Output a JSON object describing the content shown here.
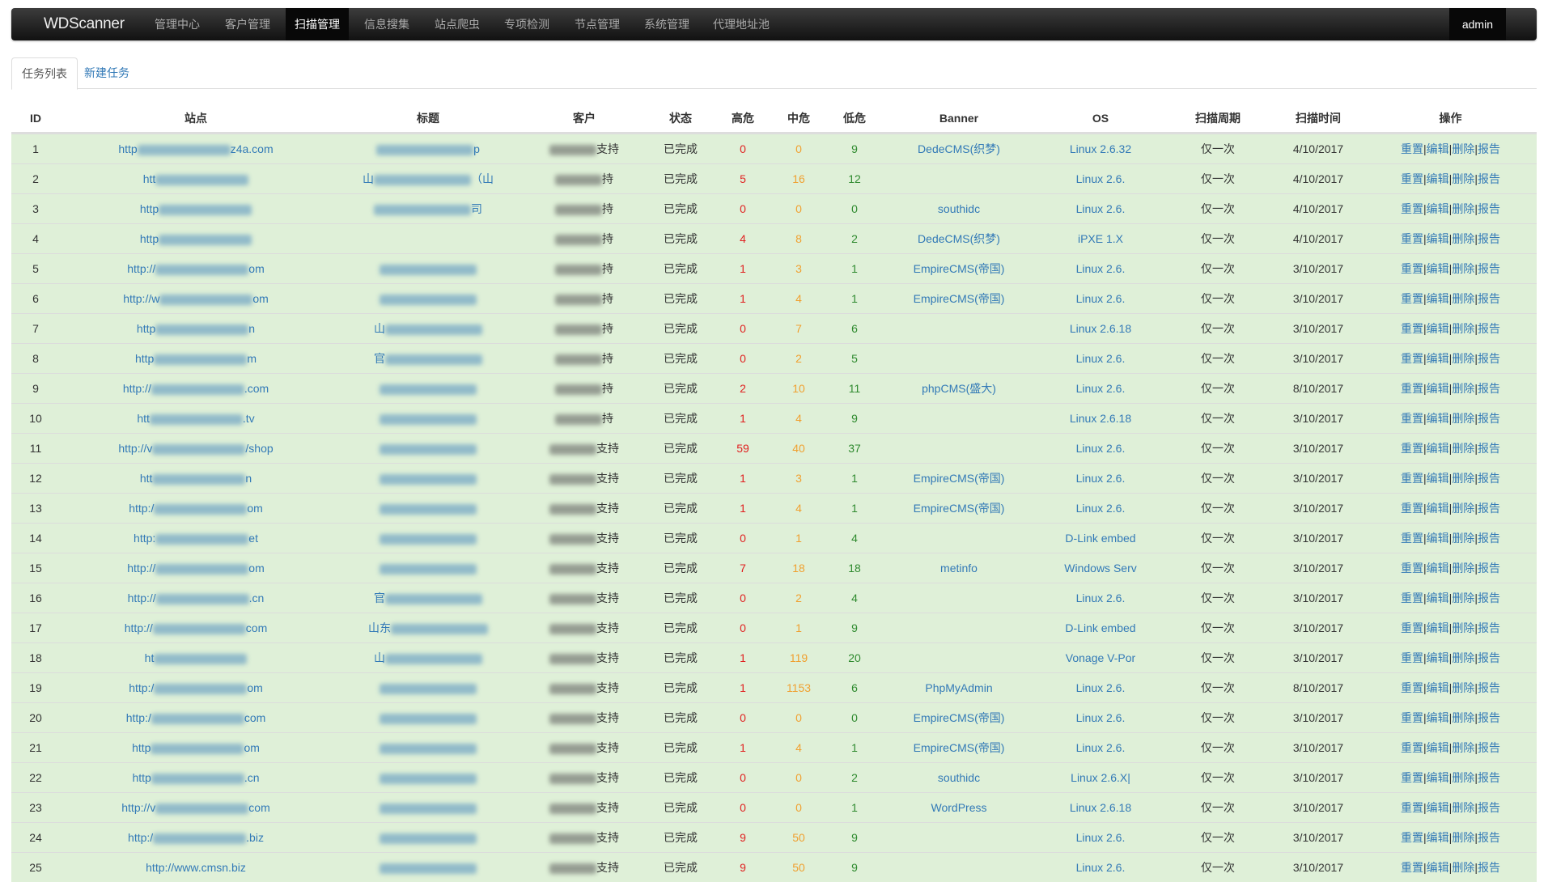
{
  "navbar": {
    "brand": "WDScanner",
    "items": [
      "管理中心",
      "客户管理",
      "扫描管理",
      "信息搜集",
      "站点爬虫",
      "专项检测",
      "节点管理",
      "系统管理",
      "代理地址池"
    ],
    "active_index": 2,
    "user": "admin"
  },
  "tabs": [
    {
      "label": "任务列表",
      "active": true
    },
    {
      "label": "新建任务",
      "active": false
    }
  ],
  "table": {
    "headers": [
      "ID",
      "站点",
      "标题",
      "客户",
      "状态",
      "高危",
      "中危",
      "低危",
      "Banner",
      "OS",
      "扫描周期",
      "扫描时间",
      "操作"
    ],
    "actions": [
      "重置",
      "编辑",
      "删除",
      "报告"
    ],
    "action_separator": "|",
    "rows": [
      {
        "id": "1",
        "site_pre": "http",
        "site_post": "z4a.com",
        "title_pre": "",
        "title_post": "p",
        "title": true,
        "cust_post": "支持",
        "status": "已完成",
        "high": "0",
        "mid": "0",
        "low": "9",
        "banner": "DedeCMS(织梦)",
        "os": "Linux 2.6.32",
        "cycle": "仅一次",
        "time": "4/10/2017"
      },
      {
        "id": "2",
        "site_pre": "htt",
        "site_post": "",
        "title_pre": "山",
        "title_post": "（山",
        "title": true,
        "cust_post": "持",
        "status": "已完成",
        "high": "5",
        "mid": "16",
        "low": "12",
        "banner": "",
        "os": "Linux 2.6.",
        "cycle": "仅一次",
        "time": "4/10/2017"
      },
      {
        "id": "3",
        "site_pre": "http",
        "site_post": "",
        "title_pre": "",
        "title_post": "司",
        "title": true,
        "cust_post": "持",
        "status": "已完成",
        "high": "0",
        "mid": "0",
        "low": "0",
        "banner": "southidc",
        "os": "Linux 2.6.",
        "cycle": "仅一次",
        "time": "4/10/2017"
      },
      {
        "id": "4",
        "site_pre": "http",
        "site_post": "",
        "title_pre": "",
        "title_post": "",
        "title": false,
        "cust_post": "持",
        "status": "已完成",
        "high": "4",
        "mid": "8",
        "low": "2",
        "banner": "DedeCMS(织梦)",
        "os": "iPXE 1.X",
        "cycle": "仅一次",
        "time": "4/10/2017"
      },
      {
        "id": "5",
        "site_pre": "http://",
        "site_post": "om",
        "title_pre": "",
        "title_post": "",
        "title": true,
        "cust_post": "持",
        "status": "已完成",
        "high": "1",
        "mid": "3",
        "low": "1",
        "banner": "EmpireCMS(帝国)",
        "os": "Linux 2.6.",
        "cycle": "仅一次",
        "time": "3/10/2017"
      },
      {
        "id": "6",
        "site_pre": "http://w",
        "site_post": "om",
        "title_pre": "",
        "title_post": "",
        "title": true,
        "cust_post": "持",
        "status": "已完成",
        "high": "1",
        "mid": "4",
        "low": "1",
        "banner": "EmpireCMS(帝国)",
        "os": "Linux 2.6.",
        "cycle": "仅一次",
        "time": "3/10/2017"
      },
      {
        "id": "7",
        "site_pre": "http",
        "site_post": "n",
        "title_pre": "山",
        "title_post": "",
        "title": true,
        "cust_post": "持",
        "status": "已完成",
        "high": "0",
        "mid": "7",
        "low": "6",
        "banner": "",
        "os": "Linux 2.6.18",
        "cycle": "仅一次",
        "time": "3/10/2017"
      },
      {
        "id": "8",
        "site_pre": "http",
        "site_post": "m",
        "title_pre": "官",
        "title_post": "",
        "title": true,
        "cust_post": "持",
        "status": "已完成",
        "high": "0",
        "mid": "2",
        "low": "5",
        "banner": "",
        "os": "Linux 2.6.",
        "cycle": "仅一次",
        "time": "3/10/2017"
      },
      {
        "id": "9",
        "site_pre": "http://",
        "site_post": ".com",
        "title_pre": "",
        "title_post": "",
        "title": true,
        "cust_post": "持",
        "status": "已完成",
        "high": "2",
        "mid": "10",
        "low": "11",
        "banner": "phpCMS(盛大)",
        "os": "Linux 2.6.",
        "cycle": "仅一次",
        "time": "8/10/2017"
      },
      {
        "id": "10",
        "site_pre": "htt",
        "site_post": ".tv",
        "title_pre": "",
        "title_post": "",
        "title": true,
        "cust_post": "持",
        "status": "已完成",
        "high": "1",
        "mid": "4",
        "low": "9",
        "banner": "",
        "os": "Linux 2.6.18",
        "cycle": "仅一次",
        "time": "3/10/2017"
      },
      {
        "id": "11",
        "site_pre": "http://v",
        "site_post": "/shop",
        "title_pre": "",
        "title_post": "",
        "title": true,
        "cust_post": "支持",
        "status": "已完成",
        "high": "59",
        "mid": "40",
        "low": "37",
        "banner": "",
        "os": "Linux 2.6.",
        "cycle": "仅一次",
        "time": "3/10/2017"
      },
      {
        "id": "12",
        "site_pre": "htt",
        "site_post": "n",
        "title_pre": "",
        "title_post": "",
        "title": true,
        "cust_post": "支持",
        "status": "已完成",
        "high": "1",
        "mid": "3",
        "low": "1",
        "banner": "EmpireCMS(帝国)",
        "os": "Linux 2.6.",
        "cycle": "仅一次",
        "time": "3/10/2017"
      },
      {
        "id": "13",
        "site_pre": "http:/",
        "site_post": "om",
        "title_pre": "",
        "title_post": "",
        "title": true,
        "cust_post": "支持",
        "status": "已完成",
        "high": "1",
        "mid": "4",
        "low": "1",
        "banner": "EmpireCMS(帝国)",
        "os": "Linux 2.6.",
        "cycle": "仅一次",
        "time": "3/10/2017"
      },
      {
        "id": "14",
        "site_pre": "http:",
        "site_post": "et",
        "title_pre": "",
        "title_post": "",
        "title": true,
        "cust_post": "支持",
        "status": "已完成",
        "high": "0",
        "mid": "1",
        "low": "4",
        "banner": "",
        "os": "D-Link embed",
        "cycle": "仅一次",
        "time": "3/10/2017"
      },
      {
        "id": "15",
        "site_pre": "http://",
        "site_post": "om",
        "title_pre": "",
        "title_post": "",
        "title": true,
        "cust_post": "支持",
        "status": "已完成",
        "high": "7",
        "mid": "18",
        "low": "18",
        "banner": "metinfo",
        "os": "Windows Serv",
        "cycle": "仅一次",
        "time": "3/10/2017"
      },
      {
        "id": "16",
        "site_pre": "http://",
        "site_post": ".cn",
        "title_pre": "官",
        "title_post": "",
        "title": true,
        "cust_post": "支持",
        "status": "已完成",
        "high": "0",
        "mid": "2",
        "low": "4",
        "banner": "",
        "os": "Linux 2.6.",
        "cycle": "仅一次",
        "time": "3/10/2017"
      },
      {
        "id": "17",
        "site_pre": "http://",
        "site_post": "com",
        "title_pre": "山东",
        "title_post": "",
        "title": true,
        "cust_post": "支持",
        "status": "已完成",
        "high": "0",
        "mid": "1",
        "low": "9",
        "banner": "",
        "os": "D-Link embed",
        "cycle": "仅一次",
        "time": "3/10/2017"
      },
      {
        "id": "18",
        "site_pre": "ht",
        "site_post": "",
        "title_pre": "山",
        "title_post": "",
        "title": true,
        "cust_post": "支持",
        "status": "已完成",
        "high": "1",
        "mid": "119",
        "low": "20",
        "banner": "",
        "os": "Vonage V-Por",
        "cycle": "仅一次",
        "time": "3/10/2017"
      },
      {
        "id": "19",
        "site_pre": "http:/",
        "site_post": "om",
        "title_pre": "",
        "title_post": "",
        "title": true,
        "cust_post": "支持",
        "status": "已完成",
        "high": "1",
        "mid": "1153",
        "low": "6",
        "banner": "PhpMyAdmin",
        "os": "Linux 2.6.",
        "cycle": "仅一次",
        "time": "8/10/2017"
      },
      {
        "id": "20",
        "site_pre": "http:/",
        "site_post": "com",
        "title_pre": "",
        "title_post": "",
        "title": true,
        "cust_post": "支持",
        "status": "已完成",
        "high": "0",
        "mid": "0",
        "low": "0",
        "banner": "EmpireCMS(帝国)",
        "os": "Linux 2.6.",
        "cycle": "仅一次",
        "time": "3/10/2017"
      },
      {
        "id": "21",
        "site_pre": "http",
        "site_post": "om",
        "title_pre": "",
        "title_post": "",
        "title": true,
        "cust_post": "支持",
        "status": "已完成",
        "high": "1",
        "mid": "4",
        "low": "1",
        "banner": "EmpireCMS(帝国)",
        "os": "Linux 2.6.",
        "cycle": "仅一次",
        "time": "3/10/2017"
      },
      {
        "id": "22",
        "site_pre": "http",
        "site_post": ".cn",
        "title_pre": "",
        "title_post": "",
        "title": true,
        "cust_post": "支持",
        "status": "已完成",
        "high": "0",
        "mid": "0",
        "low": "2",
        "banner": "southidc",
        "os": "Linux 2.6.X|",
        "cycle": "仅一次",
        "time": "3/10/2017"
      },
      {
        "id": "23",
        "site_pre": "http://v",
        "site_post": "com",
        "title_pre": "",
        "title_post": "",
        "title": true,
        "cust_post": "支持",
        "status": "已完成",
        "high": "0",
        "mid": "0",
        "low": "1",
        "banner": "WordPress",
        "os": "Linux 2.6.18",
        "cycle": "仅一次",
        "time": "3/10/2017"
      },
      {
        "id": "24",
        "site_pre": "http:/",
        "site_post": ".biz",
        "title_pre": "",
        "title_post": "",
        "title": true,
        "cust_post": "支持",
        "status": "已完成",
        "high": "9",
        "mid": "50",
        "low": "9",
        "banner": "",
        "os": "Linux 2.6.",
        "cycle": "仅一次",
        "time": "3/10/2017"
      },
      {
        "id": "25",
        "site_pre": "http://www.cmsn.biz",
        "site_post": "",
        "site_full": true,
        "title_pre": "",
        "title_post": "",
        "title": true,
        "cust_post": "支持",
        "status": "已完成",
        "high": "9",
        "mid": "50",
        "low": "9",
        "banner": "",
        "os": "Linux 2.6.",
        "cycle": "仅一次",
        "time": "3/10/2017"
      }
    ]
  },
  "colors": {
    "row_bg": "#dff0d8",
    "link": "#337ab7",
    "high": "#e02020",
    "mid": "#f0a030",
    "low": "#2f8a2f"
  }
}
